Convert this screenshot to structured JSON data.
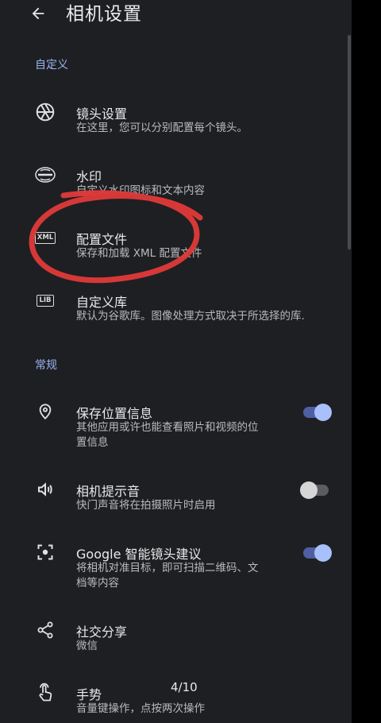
{
  "header": {
    "title": "相机设置"
  },
  "sections": [
    {
      "label": "自定义",
      "items": [
        {
          "title": "镜头设置",
          "subtitle": "在这里，您可以分别配置每个镜头。",
          "icon": "lens-aperture-icon"
        },
        {
          "title": "水印",
          "subtitle": "自定义水印图标和文本内容",
          "icon": "watermark-icon"
        },
        {
          "title": "配置文件",
          "subtitle": "保存和加载 XML 配置文件",
          "icon": "xml-icon",
          "icon_text": "XML"
        },
        {
          "title": "自定义库",
          "subtitle": "默认为谷歌库。图像处理方式取决于所选择的库.",
          "icon": "lib-icon",
          "icon_text": "LIB"
        }
      ]
    },
    {
      "label": "常规",
      "items": [
        {
          "title": "保存位置信息",
          "subtitle_line1": "其他应用或许也能查看照片和视频的位",
          "subtitle_line2": "置信息",
          "icon": "location-pin-icon",
          "toggle": true
        },
        {
          "title": "相机提示音",
          "subtitle": "快门声音将在拍摄照片时启用",
          "icon": "speaker-icon",
          "toggle": false
        },
        {
          "title": "Google 智能镜头建议",
          "subtitle_line1": "将相机对准目标，即可扫描二维码、文",
          "subtitle_line2": "档等内容",
          "icon": "google-lens-icon",
          "toggle": true
        },
        {
          "title": "社交分享",
          "subtitle": "微信",
          "icon": "share-icon"
        },
        {
          "title": "手势",
          "subtitle": "音量键操作，点按两次操作",
          "icon": "gesture-touch-icon"
        }
      ]
    }
  ],
  "page_counter": "4/10",
  "colors": {
    "background": "#1e1f22",
    "accent": "#9ab4f3",
    "toggle_on_thumb": "#a8c0fb",
    "annotation": "#e03a3a"
  }
}
